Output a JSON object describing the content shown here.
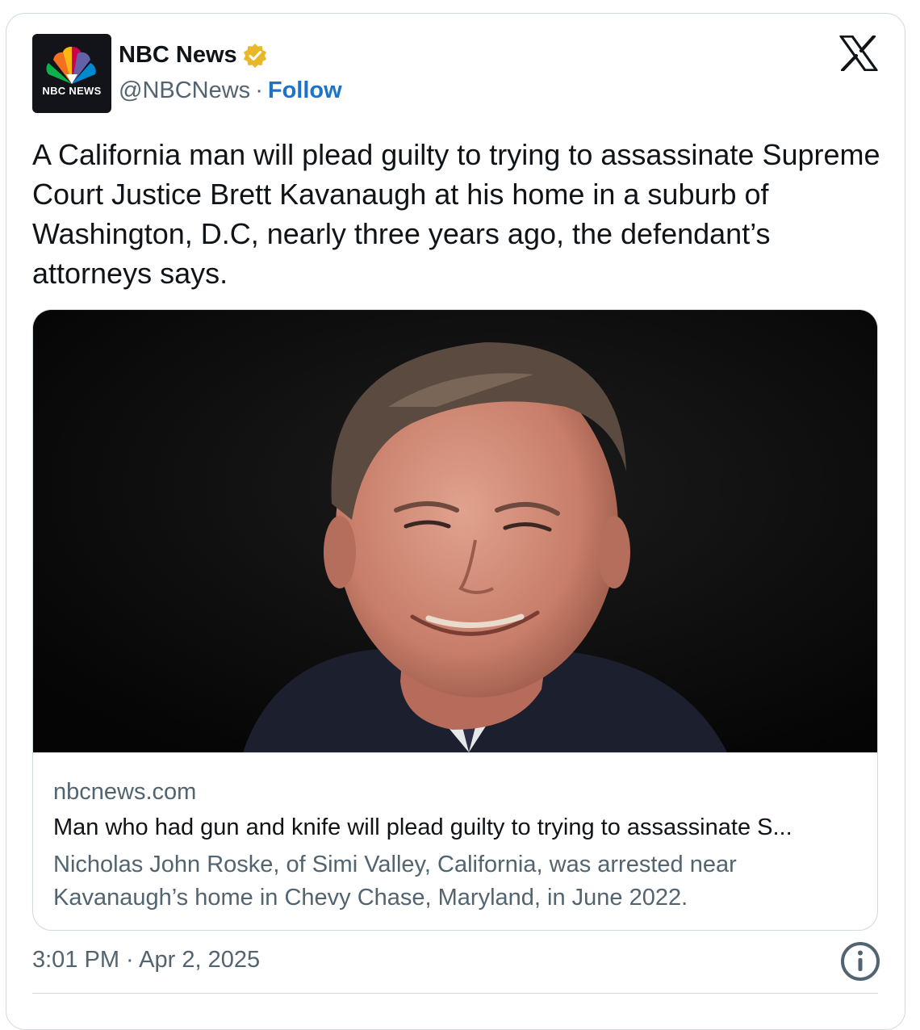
{
  "account": {
    "name": "NBC News",
    "logo_text": "NBC NEWS",
    "handle": "@NBCNews",
    "separator": "·",
    "follow_label": "Follow",
    "verified_badge_icon": "verified-gold-badge-icon"
  },
  "tweet": {
    "text": "A California man will plead guilty to trying to assassinate Supreme Court Justice Brett Kavanaugh at his home in a suburb of Washington, D.C, nearly three years ago, the defendant’s attorneys says.",
    "timestamp": "3:01 PM · Apr 2, 2025"
  },
  "link_card": {
    "domain": "nbcnews.com",
    "headline": "Man who had gun and knife will plead guilty to trying to assassinate S...",
    "description": "Nicholas John Roske, of Simi Valley, California, was arrested near Kavanaugh’s home in Chevy Chase, Maryland, in June 2022."
  },
  "icons": {
    "platform": "x-logo-icon",
    "info": "info-icon"
  },
  "colors": {
    "follow": "#1d73c8",
    "secondary_text": "#536471",
    "border": "#cfd9de",
    "badge": "#e8b829"
  }
}
